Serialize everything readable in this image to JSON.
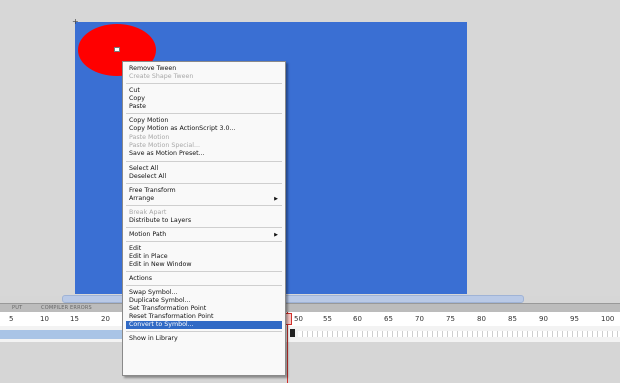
{
  "menu": {
    "items": [
      {
        "label": "Remove Tween",
        "disabled": false
      },
      {
        "label": "Create Shape Tween",
        "disabled": true
      },
      {
        "label": "Cut",
        "disabled": false
      },
      {
        "label": "Copy",
        "disabled": false
      },
      {
        "label": "Paste",
        "disabled": false
      },
      {
        "label": "Copy Motion",
        "disabled": false
      },
      {
        "label": "Copy Motion as ActionScript 3.0...",
        "disabled": false
      },
      {
        "label": "Paste Motion",
        "disabled": true
      },
      {
        "label": "Paste Motion Special...",
        "disabled": true
      },
      {
        "label": "Save as Motion Preset...",
        "disabled": false
      },
      {
        "label": "Select All",
        "disabled": false
      },
      {
        "label": "Deselect All",
        "disabled": false
      },
      {
        "label": "Free Transform",
        "disabled": false
      },
      {
        "label": "Arrange",
        "disabled": false,
        "submenu": true
      },
      {
        "label": "Break Apart",
        "disabled": true
      },
      {
        "label": "Distribute to Layers",
        "disabled": false
      },
      {
        "label": "Motion Path",
        "disabled": false,
        "submenu": true
      },
      {
        "label": "Edit",
        "disabled": false
      },
      {
        "label": "Edit in Place",
        "disabled": false
      },
      {
        "label": "Edit in New Window",
        "disabled": false
      },
      {
        "label": "Actions",
        "disabled": false
      },
      {
        "label": "Swap Symbol...",
        "disabled": false
      },
      {
        "label": "Duplicate Symbol...",
        "disabled": false
      },
      {
        "label": "Set Transformation Point",
        "disabled": false
      },
      {
        "label": "Reset Transformation Point",
        "disabled": false
      },
      {
        "label": "Convert to Symbol...",
        "disabled": false,
        "highlighted": true
      },
      {
        "label": "Show in Library",
        "disabled": false
      }
    ]
  },
  "timeline": {
    "tabs": [
      "PUT",
      "COMPILER ERRORS"
    ],
    "ruler_left": [
      "5",
      "10",
      "15",
      "20"
    ],
    "ruler_right": [
      "50",
      "55",
      "60",
      "65",
      "70",
      "75",
      "80",
      "85",
      "90",
      "95",
      "100"
    ]
  },
  "colors": {
    "stage": "#3a6fd3",
    "circle": "#ff0000",
    "highlight": "#316ac5",
    "playhead": "#d0302a"
  },
  "icons": {
    "submenu": "submenu-arrow-icon"
  }
}
